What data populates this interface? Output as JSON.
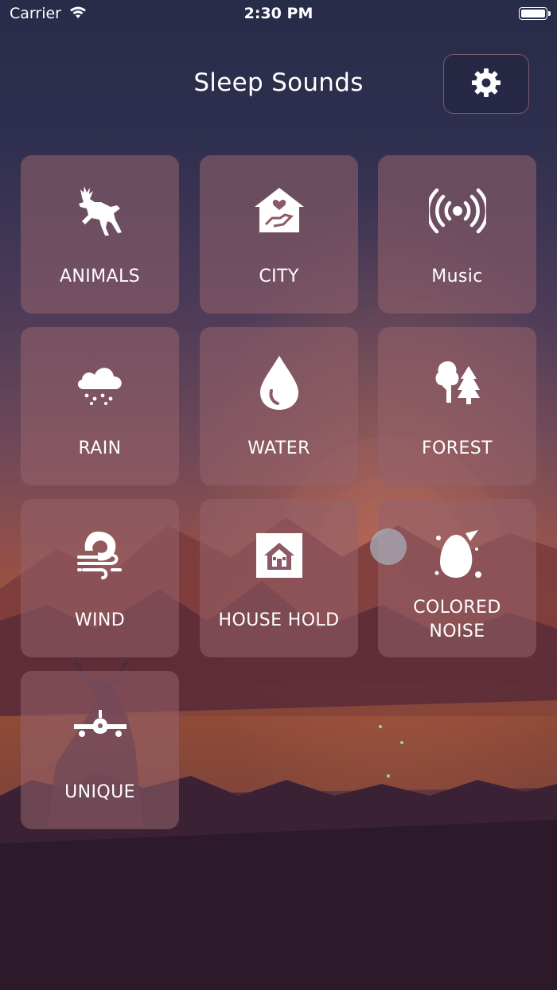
{
  "status_bar": {
    "carrier": "Carrier",
    "time": "2:30 PM"
  },
  "header": {
    "title": "Sleep Sounds",
    "settings_icon": "gear-icon"
  },
  "categories": [
    {
      "label": "ANIMALS",
      "icon": "deer-icon"
    },
    {
      "label": "CITY",
      "icon": "house-heart-icon"
    },
    {
      "label": "Music",
      "icon": "broadcast-icon"
    },
    {
      "label": "RAIN",
      "icon": "rain-cloud-icon"
    },
    {
      "label": "WATER",
      "icon": "water-drop-icon"
    },
    {
      "label": "FOREST",
      "icon": "trees-icon"
    },
    {
      "label": "WIND",
      "icon": "wind-icon"
    },
    {
      "label": "HOUSE HOLD",
      "icon": "home-icon"
    },
    {
      "label_line1": "COLORED",
      "label_line2": "NOISE",
      "icon": "paint-splash-icon"
    },
    {
      "label": "UNIQUE",
      "icon": "airplane-icon"
    }
  ],
  "colors": {
    "tile_background": "#96626c",
    "text": "#ffffff"
  }
}
